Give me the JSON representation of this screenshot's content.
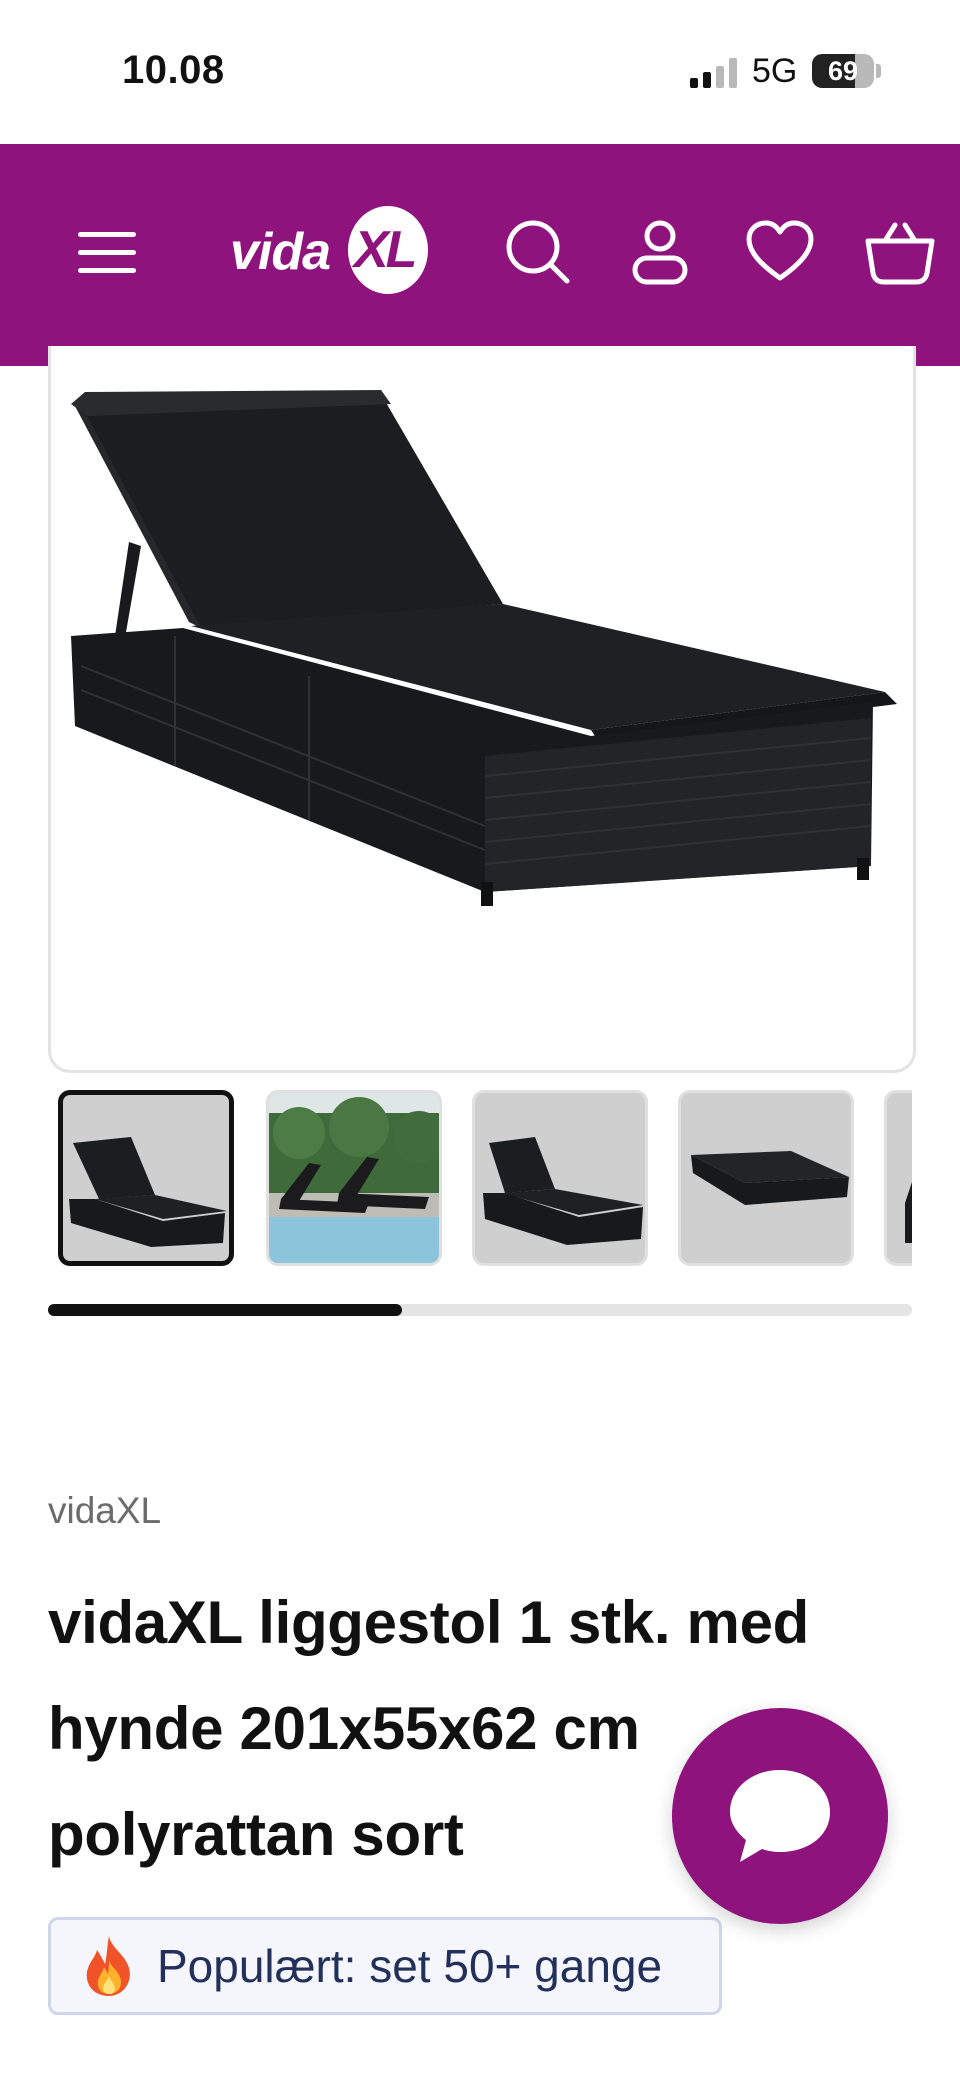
{
  "status_bar": {
    "time": "10.08",
    "network": "5G",
    "battery_percent": "69",
    "battery_level": 0.69,
    "signal_bars": 2
  },
  "header": {
    "background": "#8f137c",
    "logo_text": "vida",
    "logo_xl": "XL",
    "icons": [
      "menu-icon",
      "search-icon",
      "account-icon",
      "heart-icon",
      "basket-icon"
    ]
  },
  "gallery": {
    "thumbnail_count_visible": 5,
    "active_thumbnail": 0,
    "scroll_progress": 0.41
  },
  "product": {
    "brand": "vidaXL",
    "title": "vidaXL liggestol 1 stk. med hynde 201x55x62 cm polyrattan sort",
    "popular_badge": "Populært: set 50+ gange"
  },
  "colors": {
    "accent": "#8f137c",
    "badge_bg": "#f4f6fb",
    "badge_border": "#cfd6ea",
    "badge_text": "#233059"
  }
}
